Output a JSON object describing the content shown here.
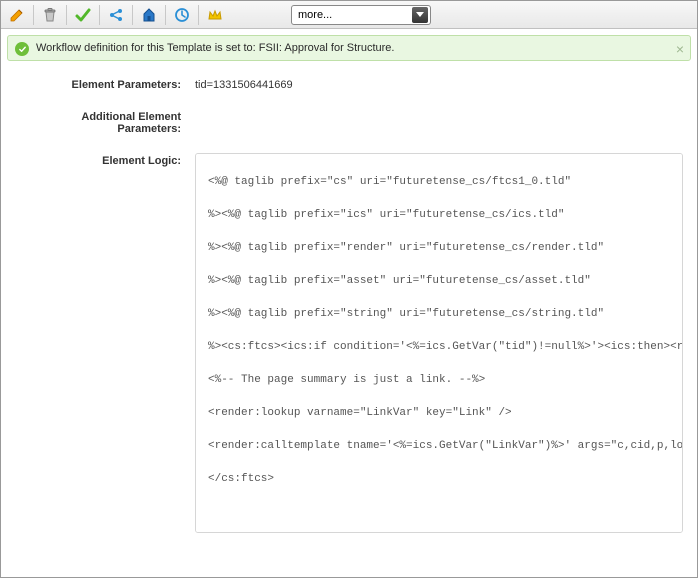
{
  "toolbar": {
    "more_label": "more..."
  },
  "notice": {
    "text": "Workflow definition for this Template is set to: FSII: Approval for Structure."
  },
  "fields": {
    "element_parameters_label": "Element Parameters:",
    "element_parameters_value": "tid=1331506441669",
    "additional_element_parameters_label": "Additional Element Parameters:",
    "element_logic_label": "Element Logic:",
    "element_logic_code": "<%@ taglib prefix=\"cs\" uri=\"futuretense_cs/ftcs1_0.tld\"\n%><%@ taglib prefix=\"ics\" uri=\"futuretense_cs/ics.tld\"\n%><%@ taglib prefix=\"render\" uri=\"futuretense_cs/render.tld\"\n%><%@ taglib prefix=\"asset\" uri=\"futuretense_cs/asset.tld\"\n%><%@ taglib prefix=\"string\" uri=\"futuretense_cs/string.tld\"\n%><cs:ftcs><ics:if condition='<%=ics.GetVar(\"tid\")!=null%>'><ics:then><render:logdep cid='<%=ics.GetVar(\"tid\")%>' c=\"Template\"/></ics:then></ics:if>\n<%-- The page summary is just a link. --%>\n<render:lookup varname=\"LinkVar\" key=\"Link\" />\n<render:calltemplate tname='<%=ics.GetVar(\"LinkVar\")%>' args=\"c,cid,p,locale\" />\n</cs:ftcs>"
  }
}
